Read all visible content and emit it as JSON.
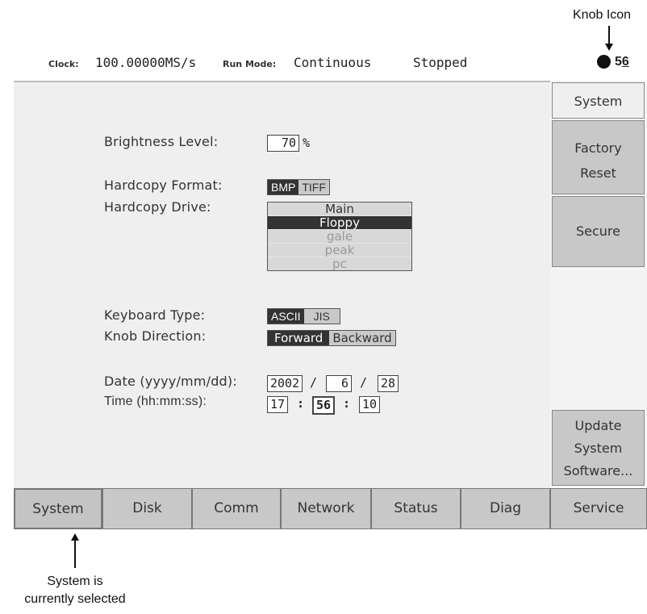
{
  "annotations": {
    "knob_icon": "Knob Icon",
    "system_selected_line1": "System is",
    "system_selected_line2": "currently selected"
  },
  "status_bar": {
    "clock_label": "Clock:",
    "clock_value": "100.00000MS/s",
    "run_mode_label": "Run Mode:",
    "run_mode_value": "Continuous",
    "state": "Stopped",
    "knob_value_prefix": "5",
    "knob_value_underlined": "6"
  },
  "settings": {
    "brightness_label": "Brightness Level:",
    "brightness_value": "70",
    "brightness_unit": "%",
    "hardcopy_format_label": "Hardcopy Format:",
    "hardcopy_format_options": [
      "BMP",
      "TIFF"
    ],
    "hardcopy_format_selected": "BMP",
    "hardcopy_drive_label": "Hardcopy Drive:",
    "hardcopy_drive_options": [
      "Main",
      "Floppy",
      "gale",
      "peak",
      "pc"
    ],
    "hardcopy_drive_selected": "Floppy",
    "keyboard_type_label": "Keyboard Type:",
    "keyboard_type_options": [
      "ASCII",
      "JIS"
    ],
    "keyboard_type_selected": "ASCII",
    "knob_direction_label": "Knob Direction:",
    "knob_direction_options": [
      "Forward",
      "Backward"
    ],
    "knob_direction_selected": "Forward",
    "date_label": "Date (yyyy/mm/dd):",
    "date_year": "2002",
    "date_month": "6",
    "date_day": "28",
    "date_sep": "/",
    "time_label": "Time (hh:mm:ss):",
    "time_hh": "17",
    "time_mm": "56",
    "time_ss": "10",
    "time_sep": ":"
  },
  "side_menu": {
    "title": "System",
    "factory_reset_line1": "Factory",
    "factory_reset_line2": "Reset",
    "secure": "Secure",
    "update_line1": "Update",
    "update_line2": "System",
    "update_line3": "Software..."
  },
  "tabs": [
    "System",
    "Disk",
    "Comm",
    "Network",
    "Status",
    "Diag",
    "Service"
  ],
  "selected_tab": "System"
}
